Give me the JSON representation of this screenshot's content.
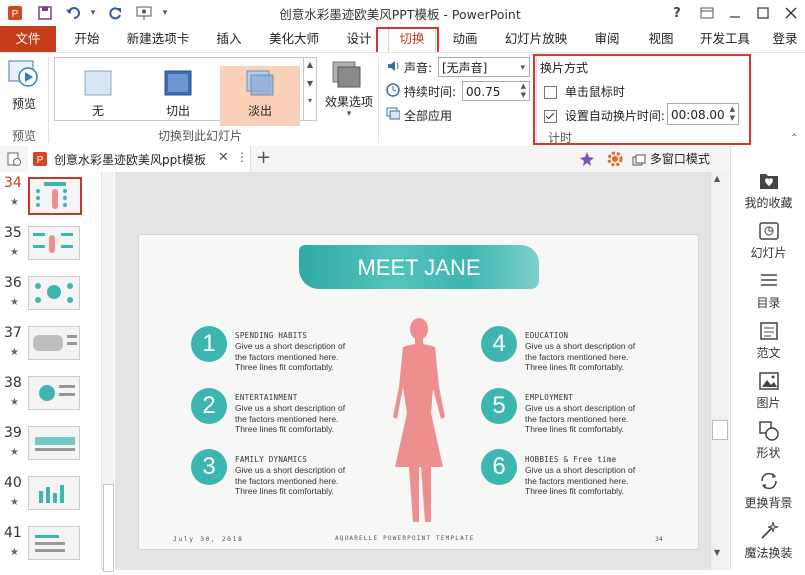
{
  "window": {
    "title": "创意水彩墨迹欧美风PPT模板 - PowerPoint",
    "help": "?",
    "controls": [
      "restore",
      "minimize",
      "maximize",
      "close"
    ]
  },
  "tabs": [
    {
      "label": "文件"
    },
    {
      "label": "开始"
    },
    {
      "label": "新建选项卡"
    },
    {
      "label": "插入"
    },
    {
      "label": "美化大师"
    },
    {
      "label": "设计"
    },
    {
      "label": "切换"
    },
    {
      "label": "动画"
    },
    {
      "label": "幻灯片放映"
    },
    {
      "label": "审阅"
    },
    {
      "label": "视图"
    },
    {
      "label": "开发工具"
    },
    {
      "label": "登录"
    }
  ],
  "ribbon": {
    "preview": {
      "label": "预览",
      "group_label": "预览"
    },
    "gallery": {
      "items": [
        {
          "label": "无"
        },
        {
          "label": "切出"
        },
        {
          "label": "淡出"
        }
      ],
      "group_label": "切换到此幻灯片"
    },
    "effects": {
      "label": "效果选项"
    },
    "timing": {
      "sound_label": "声音:",
      "sound_value": "[无声音]",
      "duration_label": "持续时间:",
      "duration_value": "00.75",
      "apply_all": "全部应用",
      "advance_title": "换片方式",
      "on_click_label": "单击鼠标时",
      "on_click_checked": false,
      "after_label": "设置自动换片时间:",
      "after_checked": true,
      "after_value": "00:08.00",
      "group_label": "计时"
    }
  },
  "doc_tab": {
    "name": "创意水彩墨迹欧美风ppt模板",
    "multi_window": "多窗口模式"
  },
  "thumbnails": [
    {
      "num": "34",
      "star": "★",
      "selected": true
    },
    {
      "num": "35",
      "star": "★",
      "selected": false
    },
    {
      "num": "36",
      "star": "★",
      "selected": false
    },
    {
      "num": "37",
      "star": "★",
      "selected": false
    },
    {
      "num": "38",
      "star": "★",
      "selected": false
    },
    {
      "num": "39",
      "star": "★",
      "selected": false
    },
    {
      "num": "40",
      "star": "★",
      "selected": false
    },
    {
      "num": "41",
      "star": "★",
      "selected": false
    }
  ],
  "slide": {
    "title": "MEET JANE",
    "items": [
      {
        "num": "1",
        "heading": "SPENDING HABITS",
        "body": [
          "Give us a short description of",
          "the factors mentioned here.",
          "Three lines fit comfortably."
        ]
      },
      {
        "num": "2",
        "heading": "ENTERTAINMENT",
        "body": [
          "Give us a short description of",
          "the factors mentioned here.",
          "Three lines fit comfortably."
        ]
      },
      {
        "num": "3",
        "heading": "FAMILY DYNAMICS",
        "body": [
          "Give us a short description of",
          "the factors mentioned here.",
          "Three lines fit comfortably."
        ]
      },
      {
        "num": "4",
        "heading": "EDUCATION",
        "body": [
          "Give us a short description of",
          "the factors mentioned here.",
          "Three lines fit comfortably."
        ]
      },
      {
        "num": "5",
        "heading": "EMPLOYMENT",
        "body": [
          "Give us a short description of",
          "the factors mentioned here.",
          "Three lines fit comfortably."
        ]
      },
      {
        "num": "6",
        "heading": "HOBBIES & Free time",
        "body": [
          "Give us a short description of",
          "the factors mentioned here.",
          "Three lines fit comfortably."
        ]
      }
    ],
    "footer_left": "July 30, 2018",
    "footer_center": "AQUARELLE POWERPOINT TEMPLATE",
    "footer_right": "34"
  },
  "right_panel": [
    {
      "label": "我的收藏",
      "icon": "favorites-icon"
    },
    {
      "label": "幻灯片",
      "icon": "slides-icon"
    },
    {
      "label": "目录",
      "icon": "toc-icon"
    },
    {
      "label": "范文",
      "icon": "sample-doc-icon"
    },
    {
      "label": "图片",
      "icon": "picture-icon"
    },
    {
      "label": "形状",
      "icon": "shapes-icon"
    },
    {
      "label": "更换背景",
      "icon": "change-background-icon"
    },
    {
      "label": "魔法换装",
      "icon": "magic-wand-icon"
    }
  ],
  "colors": {
    "file_tab": "#c43e1c",
    "accent_red": "#e03030",
    "teal": "#3db5b0",
    "silhouette": "#ee8f8f",
    "selected_gallery": "#fbd0b8"
  }
}
